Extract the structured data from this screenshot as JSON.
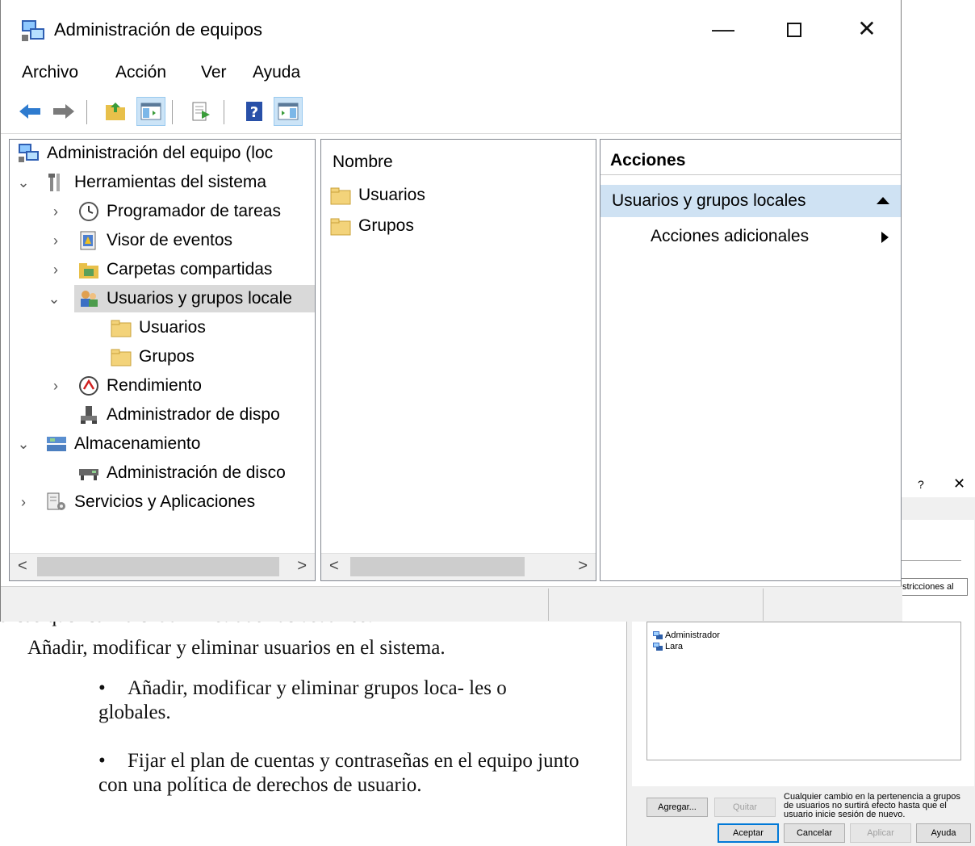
{
  "window": {
    "title": "Administración de equipos",
    "controls": {
      "minimize": "—",
      "close": "✕"
    }
  },
  "menu": [
    "Archivo",
    "Acción",
    "Ver",
    "Ayuda"
  ],
  "toolbar": {
    "icons": [
      "back-arrow-icon",
      "forward-arrow-icon",
      "up-folder-icon",
      "show-hide-tree-icon",
      "export-list-icon",
      "help-icon",
      "show-hide-action-pane-icon"
    ]
  },
  "tree": {
    "items": [
      {
        "label": "Administración del equipo (loc",
        "icon": "computer-management-icon",
        "level": 0,
        "expander": ""
      },
      {
        "label": "Herramientas del sistema",
        "icon": "tools-icon",
        "level": 0,
        "expander": "expanded"
      },
      {
        "label": "Programador de tareas",
        "icon": "clock-icon",
        "level": 1,
        "expander": "collapsed"
      },
      {
        "label": "Visor de eventos",
        "icon": "event-viewer-icon",
        "level": 1,
        "expander": "collapsed"
      },
      {
        "label": "Carpetas compartidas",
        "icon": "shared-folder-icon",
        "level": 1,
        "expander": "collapsed"
      },
      {
        "label": "Usuarios y grupos locale",
        "icon": "users-groups-icon",
        "level": 1,
        "expander": "expanded",
        "selected": true
      },
      {
        "label": "Usuarios",
        "icon": "folder-icon",
        "level": 2,
        "expander": ""
      },
      {
        "label": "Grupos",
        "icon": "folder-icon",
        "level": 2,
        "expander": ""
      },
      {
        "label": "Rendimiento",
        "icon": "performance-icon",
        "level": 1,
        "expander": "collapsed"
      },
      {
        "label": "Administrador de dispo",
        "icon": "device-manager-icon",
        "level": 1,
        "expander": ""
      },
      {
        "label": "Almacenamiento",
        "icon": "storage-icon",
        "level": 0,
        "expander": "expanded"
      },
      {
        "label": "Administración de disco",
        "icon": "disk-management-icon",
        "level": 1,
        "expander": ""
      },
      {
        "label": "Servicios y Aplicaciones",
        "icon": "services-icon",
        "level": 0,
        "expander": "collapsed"
      }
    ]
  },
  "list": {
    "column": "Nombre",
    "rows": [
      "Usuarios",
      "Grupos"
    ]
  },
  "actions": {
    "header": "Acciones",
    "group": "Usuarios y grupos locales",
    "item": "Acciones adicionales"
  },
  "dialog": {
    "help": "?",
    "close": "✕",
    "restrictions": "stricciones al",
    "members": [
      "Administrador",
      "Lara"
    ],
    "buttons": {
      "add": "Agregar...",
      "remove": "Quitar",
      "ok": "Aceptar",
      "cancel": "Cancelar",
      "apply": "Aplicar",
      "help": "Ayuda"
    },
    "note": "Cualquier cambio en la pertenencia a grupos de usuarios no surtirá efecto hasta que el usuario inicie sesión de nuevo."
  },
  "document": {
    "intro": "areas que realiza el administrador de usuarios:",
    "bullet1": "Añadir, modificar y eliminar usuarios en el sistema.",
    "bullet2": "Añadir, modificar y eliminar grupos loca- les o globales.",
    "bullet3": "Fijar el plan de cuentas y contraseñas en el equipo junto con una política de derechos de usuario.",
    "bullet_glyph": "•"
  },
  "colors": {
    "selection": "#d9d9d9",
    "action_group": "#cfe2f3",
    "toolbar_active": "#cce4f7",
    "arrow_blue": "#2e7bcf"
  }
}
